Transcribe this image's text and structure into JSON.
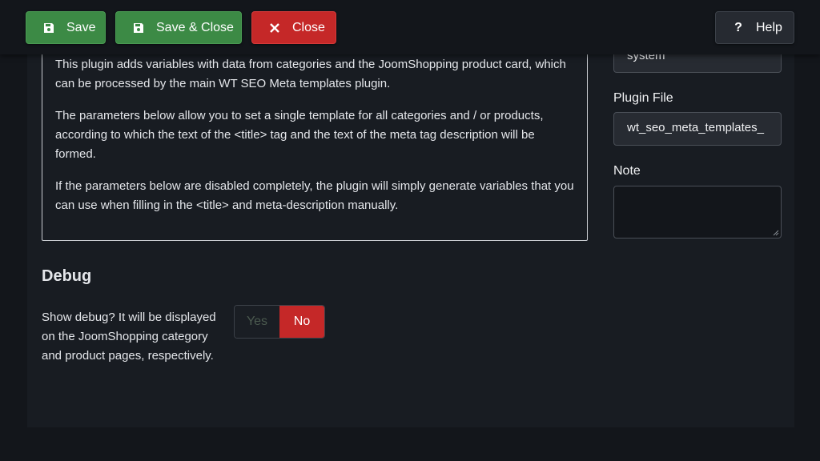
{
  "toolbar": {
    "save_label": "Save",
    "save_close_label": "Save & Close",
    "close_label": "Close",
    "help_label": "Help"
  },
  "description": {
    "paragraphs": [
      "This plugin adds variables with data from categories and the JoomShopping product card, which can be processed by the main WT SEO Meta templates plugin.",
      "The parameters below allow you to set a single template for all categories and / or products, according to which the text of the <title> tag and the text of the meta tag description will be formed.",
      "If the parameters below are disabled completely, the plugin will simply generate variables that you can use when filling in the <title> and meta-description manually."
    ]
  },
  "sidebar": {
    "type_value": "system",
    "plugin_file_label": "Plugin File",
    "plugin_file_value": "wt_seo_meta_templates_",
    "note_label": "Note",
    "note_value": ""
  },
  "debug": {
    "title": "Debug",
    "label": "Show debug? It will be displayed on the JoomShopping category and product pages, respectively.",
    "yes_label": "Yes",
    "no_label": "No",
    "selected": "No"
  },
  "colors": {
    "save_green": "#3c8a45",
    "close_red": "#c52828",
    "background": "#13161b"
  }
}
